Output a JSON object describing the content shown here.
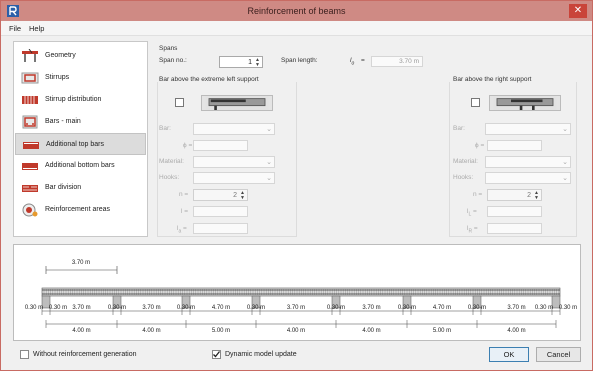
{
  "window": {
    "title": "Reinforcement of beams"
  },
  "menu": [
    {
      "label": "File"
    },
    {
      "label": "Help"
    }
  ],
  "sidebar": {
    "items": [
      {
        "label": "Geometry",
        "icon": "geometry-icon"
      },
      {
        "label": "Stirrups",
        "icon": "stirrups-icon"
      },
      {
        "label": "Stirrup distribution",
        "icon": "stirrup-distribution-icon"
      },
      {
        "label": "Bars - main",
        "icon": "bars-main-icon"
      },
      {
        "label": "Additional top bars",
        "icon": "additional-top-bars-icon",
        "selected": true
      },
      {
        "label": "Additional bottom bars",
        "icon": "additional-bottom-bars-icon"
      },
      {
        "label": "Bar division",
        "icon": "bar-division-icon"
      },
      {
        "label": "Reinforcement areas",
        "icon": "reinforcement-areas-icon"
      }
    ]
  },
  "spans": {
    "group_label": "Spans",
    "span_no_label": "Span no.:",
    "span_no_value": "1",
    "span_length_label": "Span length:",
    "l_symbol": "l",
    "l_subscript": "o",
    "equals": "=",
    "span_length_value": "3.70 m"
  },
  "left_support": {
    "title": "Bar above the extreme left support",
    "bar_label": "Bar:",
    "phi_label": "ϕ =",
    "material_label": "Material:",
    "hooks_label": "Hooks:",
    "n_label": "n =",
    "n_value": "2",
    "l_label": "l =",
    "la_label": "l",
    "la_sub": "a",
    "eq": "="
  },
  "right_support": {
    "title": "Bar above the right support",
    "bar_label": "Bar:",
    "phi_label": "ϕ =",
    "material_label": "Material:",
    "hooks_label": "Hooks:",
    "n_label": "n =",
    "n_value": "2",
    "lL_label": "l",
    "lL_sub": "L",
    "lR_label": "l",
    "lR_sub": "R",
    "eq": "="
  },
  "diagram": {
    "top_dimension": "3.70 m",
    "support_labels": [
      "0.30 m",
      "0.30 m",
      "0.30 m",
      "0.30 m",
      "0.30 m",
      "0.30 m",
      "0.30 m",
      "0.30 m",
      "0.30 m",
      "0.30 m"
    ],
    "clear_spans": [
      "3.70 m",
      "3.70 m",
      "4.70 m",
      "3.70 m",
      "3.70 m",
      "4.70 m",
      "3.70 m"
    ],
    "axis_spans": [
      "4.00 m",
      "4.00 m",
      "5.00 m",
      "4.00 m",
      "4.00 m",
      "5.00 m",
      "4.00 m"
    ]
  },
  "footer": {
    "no_generation_label": "Without reinforcement generation",
    "no_generation_checked": false,
    "dynamic_update_label": "Dynamic model update",
    "dynamic_update_checked": true,
    "ok_label": "OK",
    "cancel_label": "Cancel"
  },
  "colors": {
    "title_bar": "#cf8a84",
    "close_button": "#c9443a",
    "icon_red": "#c0392b"
  }
}
